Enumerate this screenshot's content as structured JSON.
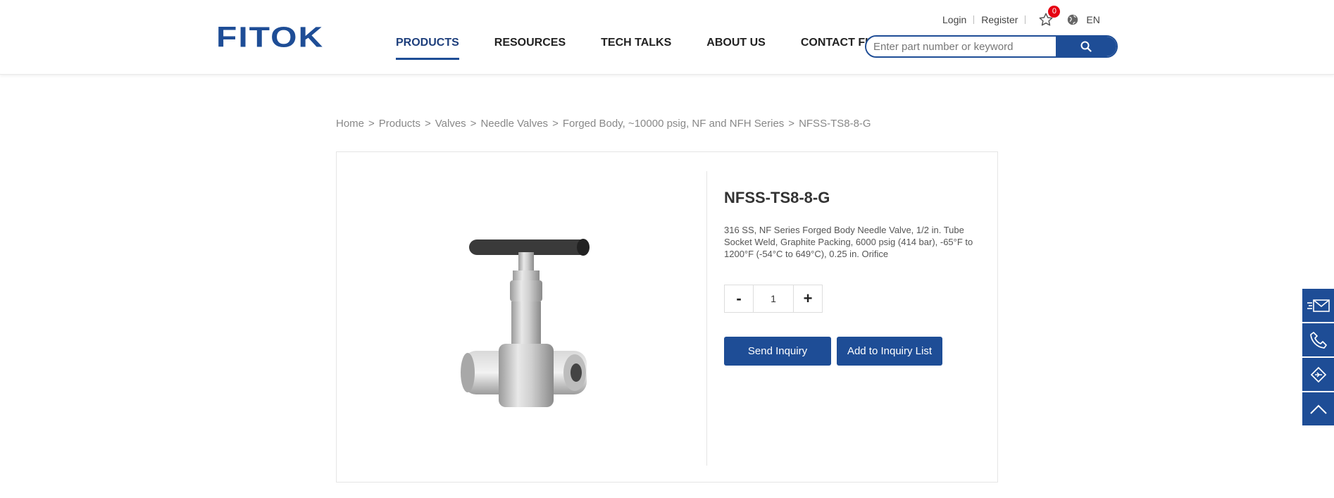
{
  "header": {
    "logo": "FITOK",
    "nav": [
      "PRODUCTS",
      "RESOURCES",
      "TECH TALKS",
      "ABOUT US",
      "CONTACT FITOK"
    ],
    "login": "Login",
    "register": "Register",
    "favorites_count": "0",
    "language": "EN",
    "search_placeholder": "Enter part number or keyword"
  },
  "breadcrumb": [
    "Home",
    "Products",
    "Valves",
    "Needle Valves",
    "Forged Body, ~10000 psig, NF and NFH Series",
    "NFSS-TS8-8-G"
  ],
  "breadcrumb_separator": ">",
  "product": {
    "title": "NFSS-TS8-8-G",
    "description": "316 SS, NF Series Forged Body Needle Valve, 1/2 in. Tube Socket Weld, Graphite Packing, 6000 psig (414 bar), -65°F to 1200°F (-54°C to 649°C), 0.25 in. Orifice",
    "quantity": "1",
    "minus": "-",
    "plus": "+",
    "send_inquiry": "Send Inquiry",
    "add_to_list": "Add to Inquiry List"
  },
  "colors": {
    "brand": "#1e4d96",
    "badge": "#e60012"
  },
  "sidebar_icons": [
    "mail-icon",
    "phone-icon",
    "handshake-icon",
    "back-to-top-icon"
  ]
}
